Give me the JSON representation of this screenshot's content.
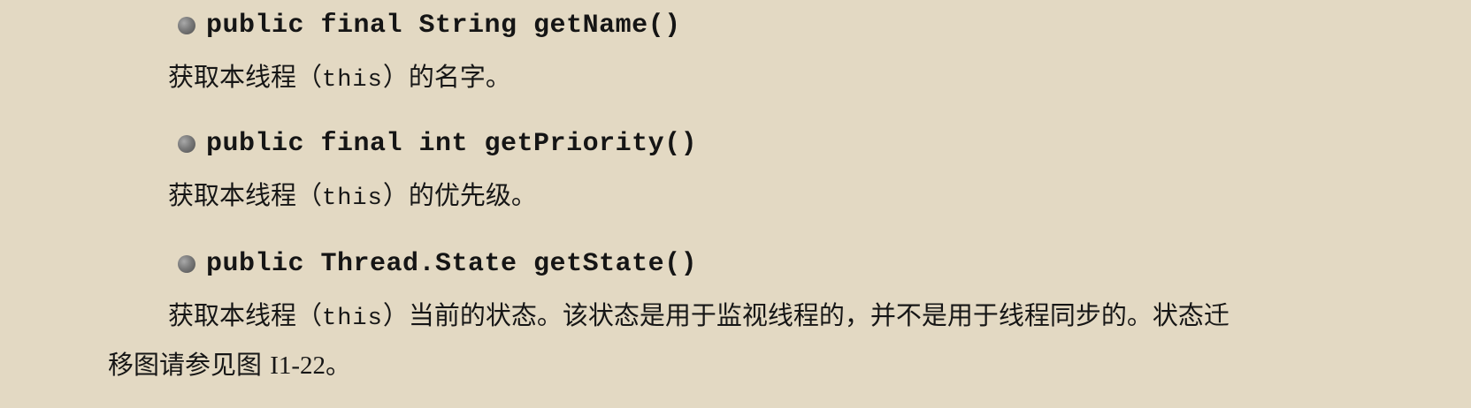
{
  "methods": [
    {
      "signature": "public final String getName()",
      "description": {
        "prefix": "获取本线程（",
        "code": "this",
        "suffix": "）的名字。"
      }
    },
    {
      "signature": "public final int getPriority()",
      "description": {
        "prefix": "获取本线程（",
        "code": "this",
        "suffix": "）的优先级。"
      }
    },
    {
      "signature": "public Thread.State getState()",
      "description": {
        "prefix": "获取本线程（",
        "code": "this",
        "suffix": "）当前的状态。该状态是用于监视线程的，并不是用于线程同步的。状态迁",
        "line2_text": "移图请参见图 ",
        "line2_ref": "I1-22",
        "line2_end": "。"
      }
    }
  ],
  "icons": {
    "bullet": "circle-bullet-icon"
  }
}
